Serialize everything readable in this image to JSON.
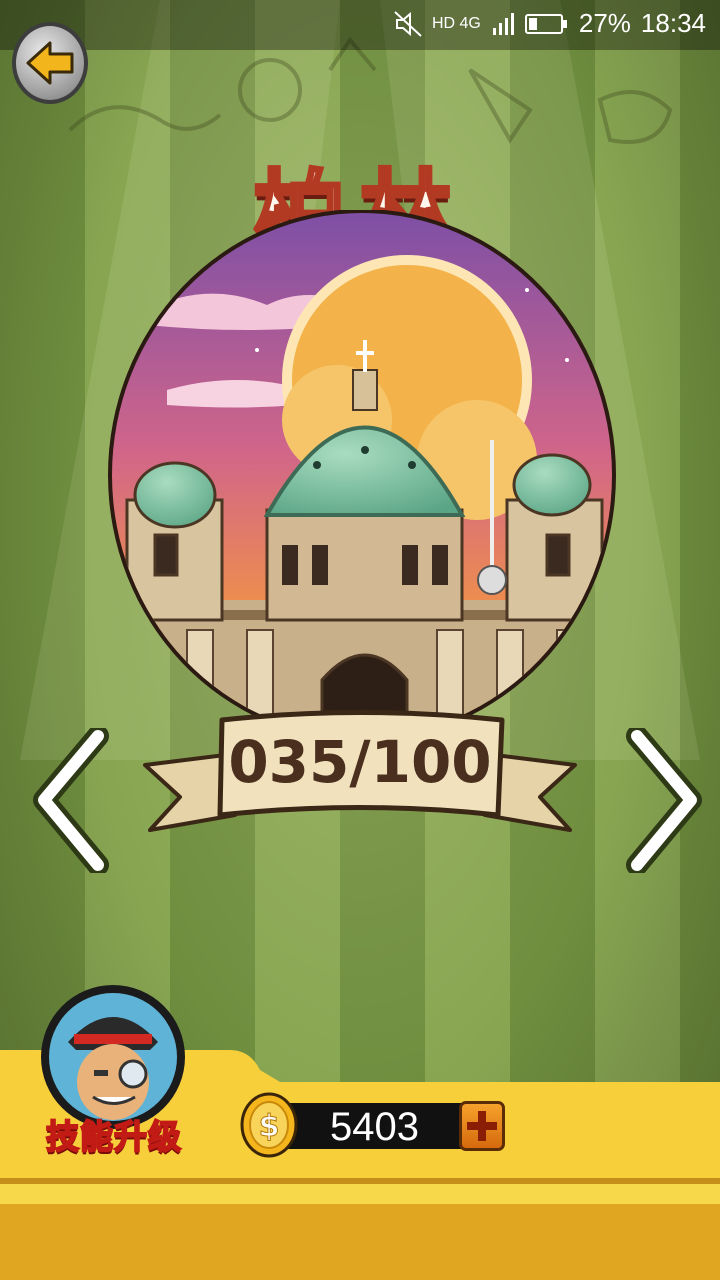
{
  "status_bar": {
    "network": "HD 4G",
    "battery_percent": "27%",
    "battery_level": 0.27,
    "time": "18:34",
    "icons": [
      "mute-icon",
      "signal-icon",
      "battery-icon"
    ]
  },
  "header": {
    "back_icon": "arrow-left-icon",
    "title": "柏林"
  },
  "level_card": {
    "image": "berlin-cathedral-illustration",
    "progress_text": "035/100",
    "progress_current": 35,
    "progress_total": 100,
    "prev_icon": "chevron-left-icon",
    "next_icon": "chevron-right-icon"
  },
  "bottom_bar": {
    "skill_upgrade_label": "技能升级",
    "coins": "5403",
    "coin_icon": "dollar-coin-icon",
    "add_icon": "plus-icon"
  },
  "colors": {
    "stripe_dark": "#6f8e3e",
    "stripe_light": "#88a652",
    "title_outline": "#b23a23",
    "bar_yellow": "#f7cf3b",
    "bar_gold": "#e0a622"
  }
}
